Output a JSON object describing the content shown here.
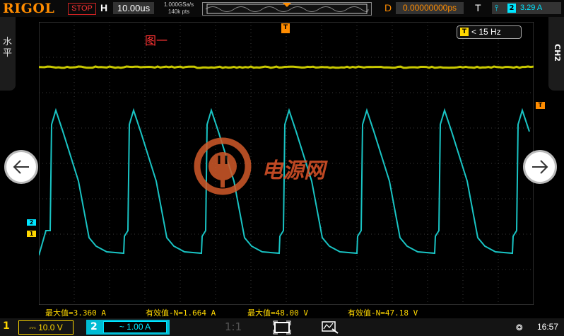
{
  "header": {
    "brand": "RIGOL",
    "run_state": "STOP",
    "horizontal_label": "H",
    "timebase": "10.00us",
    "sample_rate": "1.000GSa/s",
    "memory_depth": "140k pts",
    "delay_label": "D",
    "delay_value": "0.00000000ps",
    "trigger_label": "T",
    "trigger_source": "2",
    "trigger_level": "3.29 A"
  },
  "side_menus": {
    "left_label": "水平",
    "right_label": "CH2"
  },
  "screen": {
    "caption": "图一",
    "freq_counter_badge": "T",
    "freq_counter_value": "< 15 Hz",
    "watermark_text": "电源网",
    "ch1_marker": "1",
    "ch2_marker": "2",
    "trigger_marker": "T"
  },
  "measurements": [
    {
      "label": "最大值=3.360 A"
    },
    {
      "label": "有效值-N=1.664 A"
    },
    {
      "label": "最大值=48.00 V"
    },
    {
      "label": "有效值-N=47.18 V"
    }
  ],
  "footer": {
    "ch1_num": "1",
    "ch1_scale": "10.0 V",
    "ch2_num": "2",
    "ch2_scale": "1.00 A",
    "zoom_ratio": "1:1",
    "time": "16:57"
  },
  "colors": {
    "ch1": "#ffd700",
    "ch2": "#19c4c4",
    "trigger": "#ff8c00",
    "stop": "#ff3333"
  },
  "icons": [
    "left-arrow-icon",
    "right-arrow-icon",
    "screen-icon",
    "measure-icon",
    "usb-icon"
  ]
}
